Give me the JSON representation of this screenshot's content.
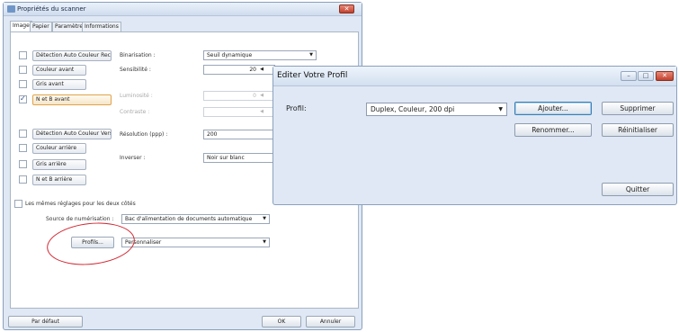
{
  "scanner_window": {
    "title": "Propriétés du scanner",
    "tabs": [
      "Image",
      "Papier",
      "Paramètre",
      "Informations"
    ],
    "image_types": [
      {
        "label": "Détection Auto Couleur Recto",
        "checked": false
      },
      {
        "label": "Couleur avant",
        "checked": false
      },
      {
        "label": "Gris avant",
        "checked": false
      },
      {
        "label": "N et B avant",
        "checked": true
      },
      {
        "label": "Détection Auto Couleur Verso",
        "checked": false
      },
      {
        "label": "Couleur arrière",
        "checked": false
      },
      {
        "label": "Gris arrière",
        "checked": false
      },
      {
        "label": "N et B arrière",
        "checked": false
      }
    ],
    "binarisation": {
      "label": "Binarisation :",
      "value": "Seuil dynamique"
    },
    "sensibilite": {
      "label": "Sensibilité :",
      "value": "20"
    },
    "luminosite": {
      "label": "Luminosité :",
      "value": "0"
    },
    "contraste": {
      "label": "Contraste :"
    },
    "resolution": {
      "label": "Résolution (ppp) :",
      "value": "200"
    },
    "inverser": {
      "label": "Inverser :",
      "value": "Noir sur blanc"
    },
    "same_settings": {
      "label": "Les mêmes réglages pour les deux côtés",
      "checked": false
    },
    "source": {
      "label": "Source de numérisation :",
      "value": "Bac d'alimentation de documents automatique"
    },
    "profils_button": "Profils...",
    "profile_select": "Personnaliser",
    "default_button": "Par défaut",
    "ok_button": "OK",
    "cancel_button": "Annuler"
  },
  "profile_dialog": {
    "title": "Editer Votre Profil",
    "profil_label": "Profil:",
    "profil_value": "Duplex, Couleur, 200 dpi",
    "add_button": "Ajouter...",
    "delete_button": "Supprimer",
    "rename_button": "Renommer...",
    "reset_button": "Réinitialiser",
    "quit_button": "Quitter"
  },
  "highlight_color": "#d12630"
}
